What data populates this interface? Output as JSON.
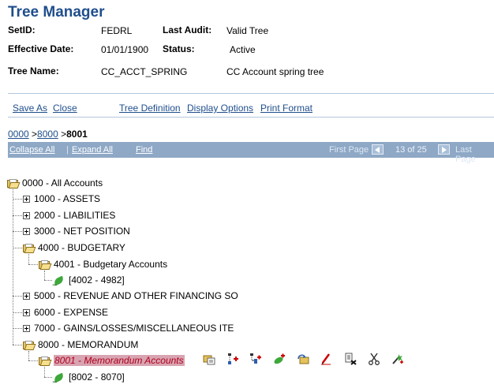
{
  "page": {
    "title": "Tree Manager"
  },
  "fields": {
    "setid_label": "SetID:",
    "setid_value": "FEDRL",
    "last_audit_label": "Last Audit:",
    "last_audit_value": "Valid Tree",
    "effective_date_label": "Effective Date:",
    "effective_date_value": "01/01/1900",
    "status_label": "Status:",
    "status_value": "Active",
    "tree_name_label": "Tree Name:",
    "tree_name_value": "CC_ACCT_SPRING",
    "tree_description": "CC Account spring tree"
  },
  "actions": {
    "save_as": "Save As",
    "close": "Close",
    "tree_definition": "Tree Definition",
    "display_options": "Display Options",
    "print_format": "Print Format"
  },
  "breadcrumb": {
    "level1": "0000",
    "sep1": " >",
    "level2": "8000",
    "sep2": " >",
    "current": "8001"
  },
  "navbar": {
    "collapse_all": "Collapse All",
    "separator": "|",
    "expand_all": "Expand All",
    "find": "Find",
    "first_page": "First Page",
    "page_info": "13 of 25",
    "last_page": "Last Page"
  },
  "tree": {
    "root": "0000 - All Accounts",
    "n1000": "1000 - ASSETS",
    "n2000": "2000 - LIABILITIES",
    "n3000": "3000 - NET POSITION",
    "n4000": "4000 - BUDGETARY",
    "n4001": "4001 - Budgetary Accounts",
    "r4001": "[4002 - 4982]",
    "n5000": "5000 - REVENUE AND OTHER FINANCING SO",
    "n6000": "6000 - EXPENSE",
    "n7000": "7000 - GAINS/LOSSES/MISCELLANEOUS ITE",
    "n8000": "8000 - MEMORANDUM",
    "n8001": "8001 - Memorandum Accounts",
    "r8001": "[8002 - 8070]"
  },
  "toolbar_icons": [
    "edit-data-icon",
    "insert-sibling-icon",
    "insert-child-icon",
    "insert-detail-icon",
    "move-node-icon",
    "edit-node-icon",
    "delete-node-icon",
    "cut-node-icon",
    "insert-range-icon"
  ],
  "colors": {
    "title": "#1f4e8c",
    "link": "#1f4e8c",
    "navbar": "#8ea8c6",
    "selected_bg": "#d8a4b1",
    "selected_text": "#b0001e",
    "leaf": "#3ea83a",
    "folder": "#e6c35a"
  }
}
